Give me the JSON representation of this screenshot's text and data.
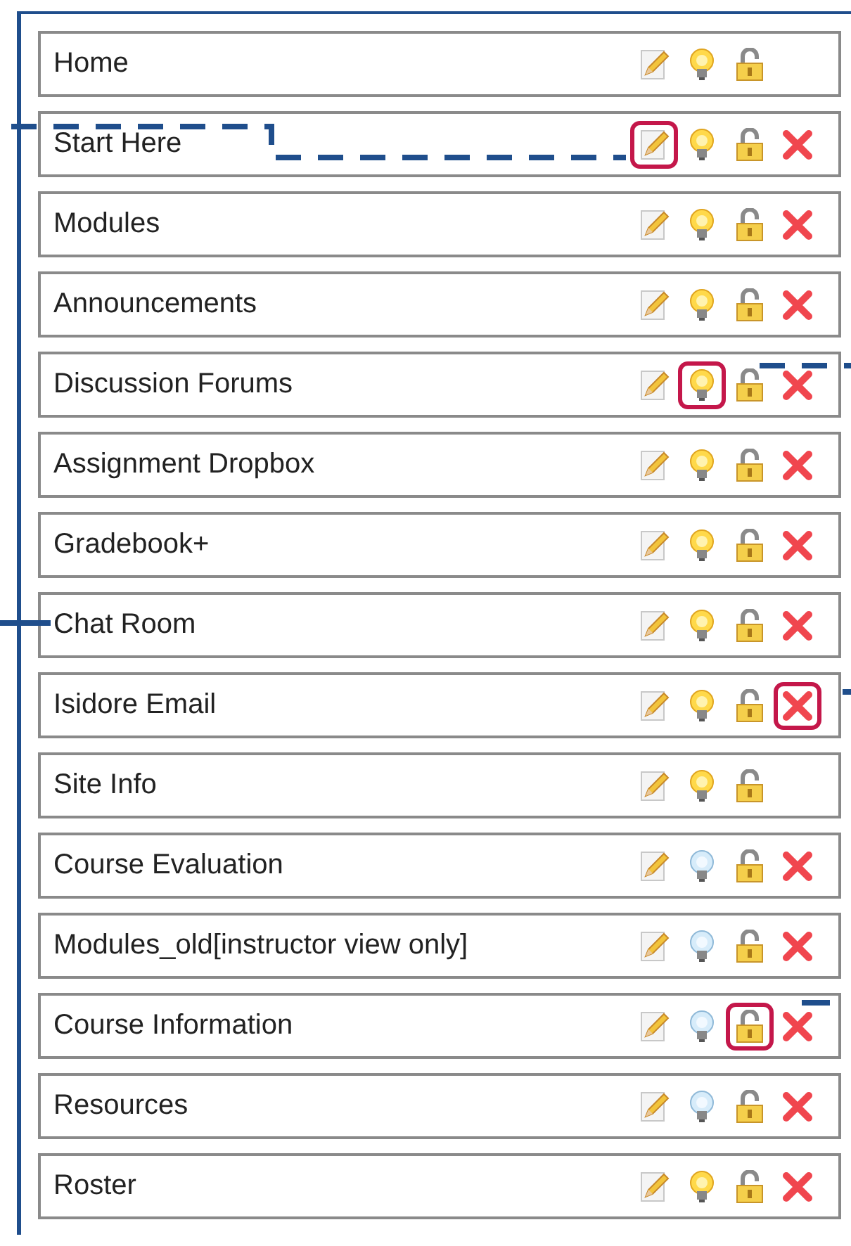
{
  "tools": [
    {
      "label": "Home",
      "actions": [
        {
          "kind": "edit",
          "highlighted": false
        },
        {
          "kind": "visibility",
          "visible": true,
          "highlighted": false
        },
        {
          "kind": "lock",
          "highlighted": false
        }
      ]
    },
    {
      "label": "Start Here",
      "actions": [
        {
          "kind": "edit",
          "highlighted": true
        },
        {
          "kind": "visibility",
          "visible": true,
          "highlighted": false
        },
        {
          "kind": "lock",
          "highlighted": false
        },
        {
          "kind": "delete",
          "highlighted": false
        }
      ]
    },
    {
      "label": "Modules",
      "actions": [
        {
          "kind": "edit",
          "highlighted": false
        },
        {
          "kind": "visibility",
          "visible": true,
          "highlighted": false
        },
        {
          "kind": "lock",
          "highlighted": false
        },
        {
          "kind": "delete",
          "highlighted": false
        }
      ]
    },
    {
      "label": "Announcements",
      "actions": [
        {
          "kind": "edit",
          "highlighted": false
        },
        {
          "kind": "visibility",
          "visible": true,
          "highlighted": false
        },
        {
          "kind": "lock",
          "highlighted": false
        },
        {
          "kind": "delete",
          "highlighted": false
        }
      ]
    },
    {
      "label": "Discussion Forums",
      "actions": [
        {
          "kind": "edit",
          "highlighted": false
        },
        {
          "kind": "visibility",
          "visible": true,
          "highlighted": true
        },
        {
          "kind": "lock",
          "highlighted": false
        },
        {
          "kind": "delete",
          "highlighted": false
        }
      ]
    },
    {
      "label": "Assignment Dropbox",
      "actions": [
        {
          "kind": "edit",
          "highlighted": false
        },
        {
          "kind": "visibility",
          "visible": true,
          "highlighted": false
        },
        {
          "kind": "lock",
          "highlighted": false
        },
        {
          "kind": "delete",
          "highlighted": false
        }
      ]
    },
    {
      "label": "Gradebook+",
      "actions": [
        {
          "kind": "edit",
          "highlighted": false
        },
        {
          "kind": "visibility",
          "visible": true,
          "highlighted": false
        },
        {
          "kind": "lock",
          "highlighted": false
        },
        {
          "kind": "delete",
          "highlighted": false
        }
      ]
    },
    {
      "label": "Chat Room",
      "actions": [
        {
          "kind": "edit",
          "highlighted": false
        },
        {
          "kind": "visibility",
          "visible": true,
          "highlighted": false
        },
        {
          "kind": "lock",
          "highlighted": false
        },
        {
          "kind": "delete",
          "highlighted": false
        }
      ]
    },
    {
      "label": "Isidore Email",
      "actions": [
        {
          "kind": "edit",
          "highlighted": false
        },
        {
          "kind": "visibility",
          "visible": true,
          "highlighted": false
        },
        {
          "kind": "lock",
          "highlighted": false
        },
        {
          "kind": "delete",
          "highlighted": true
        }
      ]
    },
    {
      "label": "Site Info",
      "actions": [
        {
          "kind": "edit",
          "highlighted": false
        },
        {
          "kind": "visibility",
          "visible": true,
          "highlighted": false
        },
        {
          "kind": "lock",
          "highlighted": false
        }
      ]
    },
    {
      "label": "Course Evaluation",
      "actions": [
        {
          "kind": "edit",
          "highlighted": false
        },
        {
          "kind": "visibility",
          "visible": false,
          "highlighted": false
        },
        {
          "kind": "lock",
          "highlighted": false
        },
        {
          "kind": "delete",
          "highlighted": false
        }
      ]
    },
    {
      "label": "Modules_old[instructor view only]",
      "actions": [
        {
          "kind": "edit",
          "highlighted": false
        },
        {
          "kind": "visibility",
          "visible": false,
          "highlighted": false
        },
        {
          "kind": "lock",
          "highlighted": false
        },
        {
          "kind": "delete",
          "highlighted": false
        }
      ]
    },
    {
      "label": "Course Information",
      "actions": [
        {
          "kind": "edit",
          "highlighted": false
        },
        {
          "kind": "visibility",
          "visible": false,
          "highlighted": false
        },
        {
          "kind": "lock",
          "highlighted": true
        },
        {
          "kind": "delete",
          "highlighted": false
        }
      ]
    },
    {
      "label": "Resources",
      "actions": [
        {
          "kind": "edit",
          "highlighted": false
        },
        {
          "kind": "visibility",
          "visible": false,
          "highlighted": false
        },
        {
          "kind": "lock",
          "highlighted": false
        },
        {
          "kind": "delete",
          "highlighted": false
        }
      ]
    },
    {
      "label": "Roster",
      "actions": [
        {
          "kind": "edit",
          "highlighted": false
        },
        {
          "kind": "visibility",
          "visible": true,
          "highlighted": false
        },
        {
          "kind": "lock",
          "highlighted": false
        },
        {
          "kind": "delete",
          "highlighted": false
        }
      ]
    }
  ]
}
